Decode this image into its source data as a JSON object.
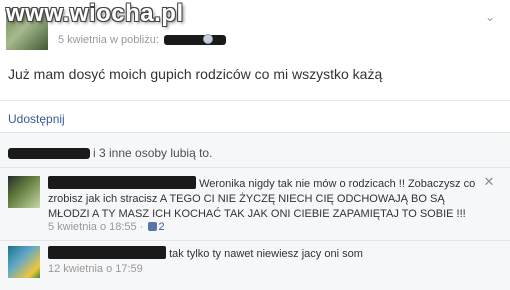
{
  "watermark": "www.wiocha.pl",
  "post": {
    "meta": "5 kwietnia w pobliżu:",
    "text": "Już mam dosyć moich gupich rodziców co mi wszystko każą",
    "share_label": "Udostępnij",
    "likes_text": "i 3 inne osoby lubią to."
  },
  "comments": [
    {
      "text": "Weronika nigdy tak nie mów o rodzicach !! Zobaczysz co zrobisz jak ich stracisz A TEGO CI NIE ŻYCZĘ NIECH CIĘ ODCHOWAJĄ BO SĄ MŁODZI A TY MASZ ICH KOCHAĆ TAK JAK ONI CIEBIE ZAPAMIĘTAJ TO SOBIE !!!",
      "time": "5 kwietnia o 18:55",
      "separator": "·",
      "like_count": "2"
    },
    {
      "text": "tak tylko ty nawet niewiesz jacy oni som",
      "time": "12 kwietnia o 17:59"
    }
  ],
  "icons": {
    "globe": "globe-icon",
    "chevron": "chevron-down-icon",
    "close": "close-icon",
    "thumb": "thumbs-up-icon"
  },
  "colors": {
    "link": "#3b5998",
    "meta": "#999999",
    "feedback_bg": "#f6f7f9"
  }
}
